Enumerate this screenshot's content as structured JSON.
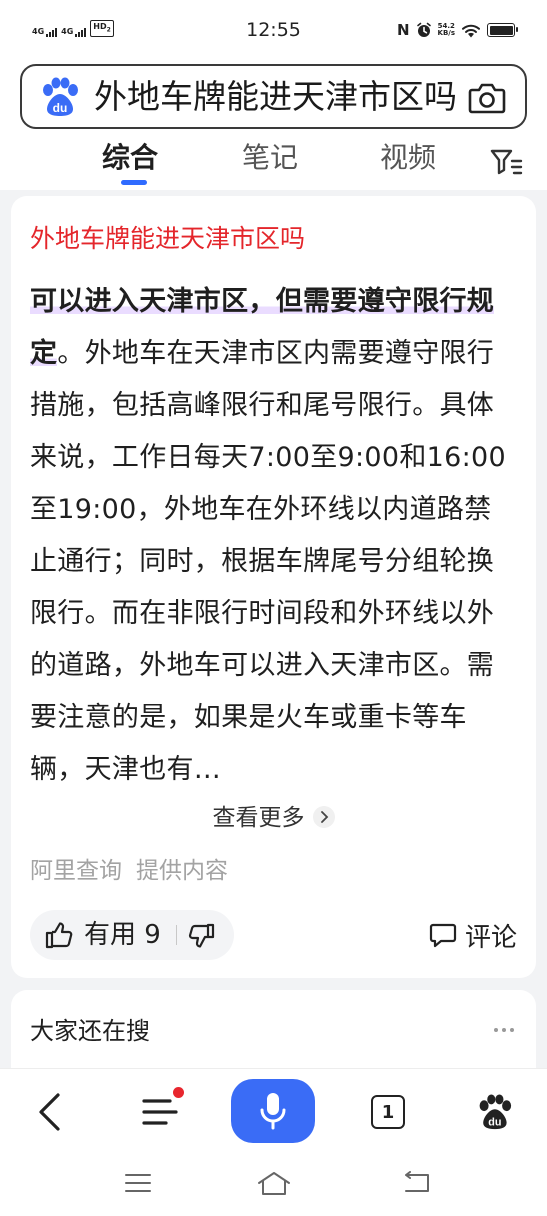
{
  "status_bar": {
    "time": "12:55",
    "sim1": "4G",
    "sim2": "4G",
    "hd": "HD",
    "hd_sub": "2",
    "speed_value": "54.2",
    "speed_unit": "KB/s",
    "nfc": "N"
  },
  "search": {
    "query": "外地车牌能进天津市区吗"
  },
  "tabs": [
    {
      "label": "综合",
      "active": true
    },
    {
      "label": "笔记",
      "active": false
    },
    {
      "label": "视频",
      "active": false
    }
  ],
  "answer_card": {
    "title": "外地车牌能进天津市区吗",
    "highlight": "可以进入天津市区，但需要遵守限行规定",
    "body": "。外地车在天津市区内需要遵守限行措施，包括高峰限行和尾号限行。具体来说，工作日每天7:00至9:00和16:00至19:00，外地车在外环线以内道路禁止通行；同时，根据车牌尾号分组轮换限行。而在非限行时间段和外环线以外的道路，外地车可以进入天津市区。需要注意的是，如果是火车或重卡等车辆，天津也有…",
    "more_label": "查看更多",
    "source_name": "阿里查询",
    "source_suffix": "提供内容",
    "useful_label": "有用 9",
    "comment_label": "评论"
  },
  "related": {
    "title": "大家还在搜"
  },
  "bottom_nav": {
    "tab_count": "1",
    "accent": "#3a6cf6",
    "notify_color": "#e8262e"
  },
  "colors": {
    "title_red": "#e4262b",
    "tab_indicator": "#2f6bff",
    "highlight_bg": "#eadcff"
  },
  "icons": [
    "baidu-paw-logo",
    "camera-icon",
    "filter-icon",
    "thumb-up-icon",
    "thumb-down-icon",
    "comment-icon",
    "back-icon",
    "menu-icon",
    "mic-icon",
    "tab-count-icon",
    "baidu-home-icon"
  ]
}
